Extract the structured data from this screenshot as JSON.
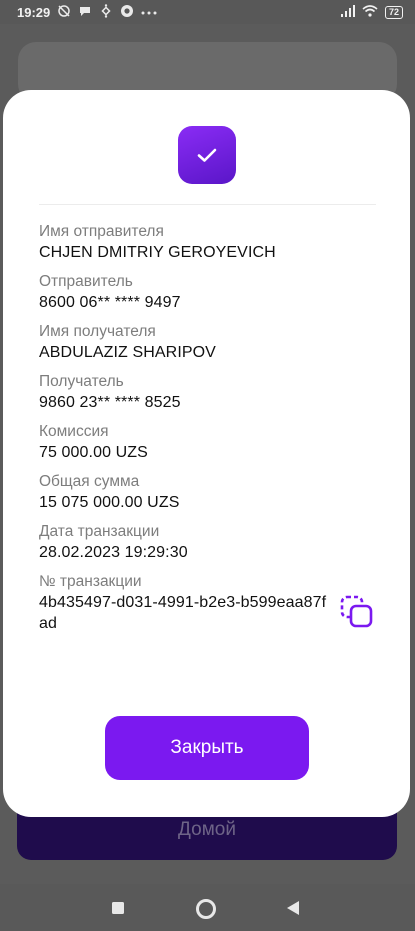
{
  "status_bar": {
    "time": "19:29",
    "left_icons": [
      "sync-off-icon",
      "chat-bubble-icon",
      "binance-icon",
      "chrome-icon",
      "more-dots-icon"
    ],
    "battery": "72"
  },
  "background": {
    "home_button_label": "Домой"
  },
  "modal": {
    "fields": [
      {
        "label": "Имя отправителя",
        "value": "CHJEN DMITRIY GEROYEVICH"
      },
      {
        "label": "Отправитель",
        "value": "8600 06** **** 9497"
      },
      {
        "label": "Имя получателя",
        "value": "ABDULAZIZ SHARIPOV"
      },
      {
        "label": "Получатель",
        "value": "9860 23** **** 8525"
      },
      {
        "label": "Комиссия",
        "value": "75 000.00 UZS"
      },
      {
        "label": "Общая сумма",
        "value": "15 075 000.00 UZS"
      },
      {
        "label": "Дата транзакции",
        "value": "28.02.2023 19:29:30"
      },
      {
        "label": "№ транзакции",
        "value": "4b435497-d031-4991-b2e3-b599eaa87fad"
      }
    ],
    "close_label": "Закрыть"
  },
  "colors": {
    "accent": "#7b19f0",
    "badge_gradient_start": "#8a2cf5",
    "badge_gradient_end": "#5a16c8"
  }
}
